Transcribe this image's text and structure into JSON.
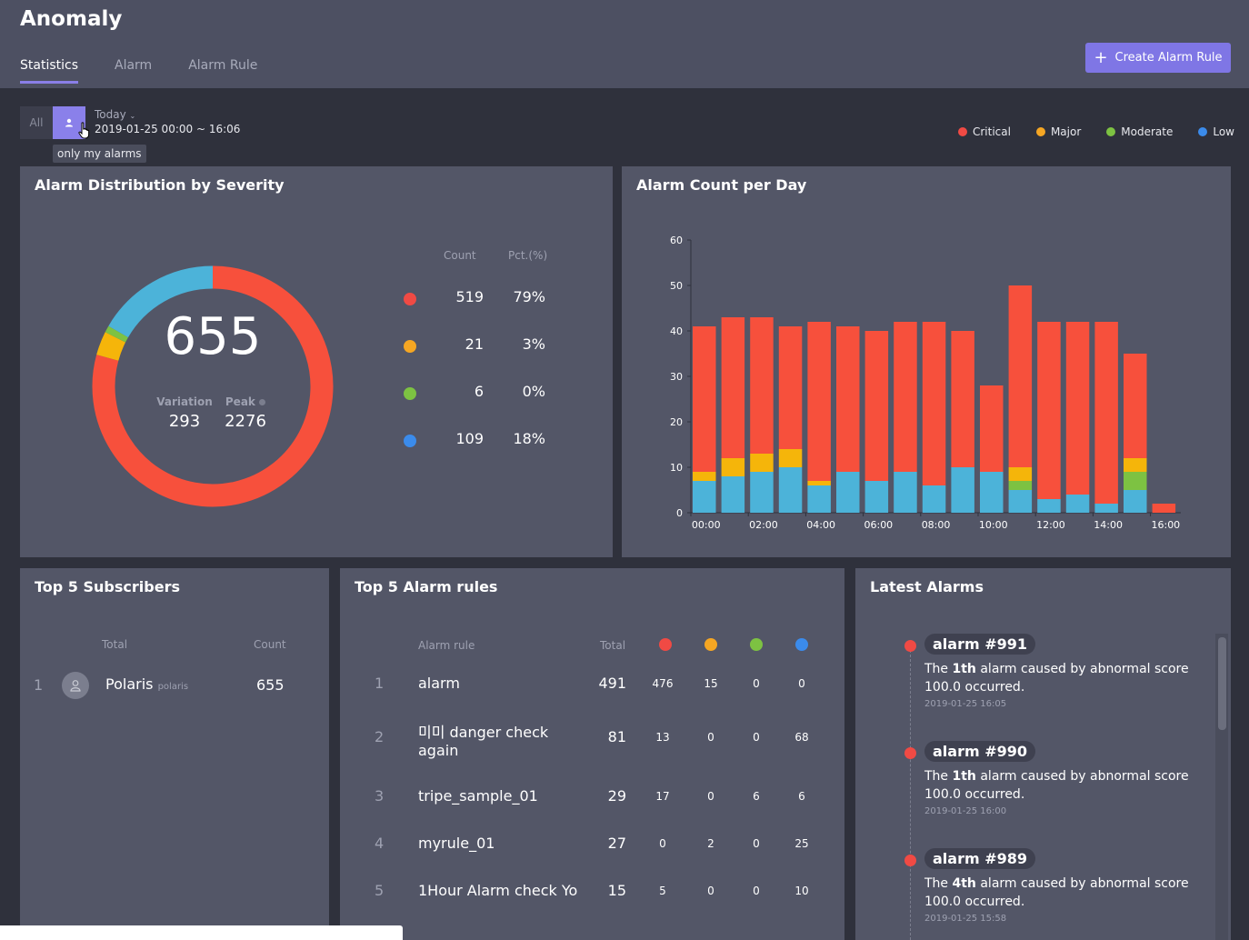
{
  "header": {
    "title": "Anomaly",
    "tabs": [
      "Statistics",
      "Alarm",
      "Alarm Rule"
    ],
    "create_button": "Create Alarm Rule"
  },
  "filter": {
    "all_label": "All",
    "tooltip": "only my alarms",
    "range_label": "Today",
    "range_value": "2019-01-25 00:00 ~ 16:06"
  },
  "legend": [
    {
      "label": "Critical",
      "color": "#f04a44"
    },
    {
      "label": "Major",
      "color": "#f5a623"
    },
    {
      "label": "Moderate",
      "color": "#7dc242"
    },
    {
      "label": "Low",
      "color": "#3b8beb"
    }
  ],
  "severity": {
    "title": "Alarm Distribution by Severity",
    "total": "655",
    "variation_label": "Variation",
    "variation_value": "293",
    "peak_label": "Peak",
    "peak_value": "2276",
    "col_count": "Count",
    "col_pct": "Pct.(%)",
    "rows": [
      {
        "count": "519",
        "pct": "79%",
        "color": "#f04a44"
      },
      {
        "count": "21",
        "pct": "3%",
        "color": "#f5a623"
      },
      {
        "count": "6",
        "pct": "0%",
        "color": "#7dc242"
      },
      {
        "count": "109",
        "pct": "18%",
        "color": "#3b8beb"
      }
    ],
    "donut": [
      {
        "label": "Critical",
        "value": 519,
        "color": "#f7503c"
      },
      {
        "label": "Major",
        "value": 21,
        "color": "#f5b50a"
      },
      {
        "label": "Moderate",
        "value": 6,
        "color": "#7dc242"
      },
      {
        "label": "Low",
        "value": 109,
        "color": "#4cb3d9"
      }
    ]
  },
  "chart_data": {
    "type": "bar",
    "title": "Alarm Count per Day",
    "xlabel": "",
    "ylabel": "",
    "ylim": [
      0,
      60
    ],
    "yticks": [
      0,
      10,
      20,
      30,
      40,
      50,
      60
    ],
    "xtick_labels": [
      "00:00",
      "02:00",
      "04:00",
      "06:00",
      "08:00",
      "10:00",
      "12:00",
      "14:00",
      "16:00"
    ],
    "categories": [
      "00:00",
      "01:00",
      "02:00",
      "03:00",
      "04:00",
      "05:00",
      "06:00",
      "07:00",
      "08:00",
      "09:00",
      "10:00",
      "11:00",
      "12:00",
      "13:00",
      "14:00",
      "15:00",
      "16:00"
    ],
    "stacked": true,
    "series": [
      {
        "name": "Low",
        "color": "#4cb3d9",
        "values": [
          7,
          8,
          9,
          10,
          6,
          9,
          7,
          9,
          6,
          10,
          9,
          5,
          3,
          4,
          2,
          5,
          0
        ]
      },
      {
        "name": "Moderate",
        "color": "#7dc242",
        "values": [
          0,
          0,
          0,
          0,
          0,
          0,
          0,
          0,
          0,
          0,
          0,
          2,
          0,
          0,
          0,
          4,
          0
        ]
      },
      {
        "name": "Major",
        "color": "#f5b50a",
        "values": [
          2,
          4,
          4,
          4,
          1,
          0,
          0,
          0,
          0,
          0,
          0,
          3,
          0,
          0,
          0,
          3,
          0
        ]
      },
      {
        "name": "Critical",
        "color": "#f7503c",
        "values": [
          32,
          31,
          30,
          27,
          35,
          32,
          33,
          33,
          36,
          30,
          19,
          40,
          39,
          38,
          40,
          23,
          2
        ]
      }
    ]
  },
  "subscribers": {
    "title": "Top 5 Subscribers",
    "col_total": "Total",
    "col_count": "Count",
    "rows": [
      {
        "rank": "1",
        "name": "Polaris",
        "id": "polaris",
        "count": "655"
      }
    ]
  },
  "rules": {
    "title": "Top 5 Alarm rules",
    "col_rule": "Alarm rule",
    "col_total": "Total",
    "rows": [
      {
        "rank": "1",
        "name": "alarm",
        "total": "491",
        "c": "476",
        "ma": "15",
        "mo": "0",
        "lo": "0"
      },
      {
        "rank": "2",
        "name": "미미 danger check again",
        "total": "81",
        "c": "13",
        "ma": "0",
        "mo": "0",
        "lo": "68"
      },
      {
        "rank": "3",
        "name": "tripe_sample_01",
        "total": "29",
        "c": "17",
        "ma": "0",
        "mo": "6",
        "lo": "6"
      },
      {
        "rank": "4",
        "name": "myrule_01",
        "total": "27",
        "c": "0",
        "ma": "2",
        "mo": "0",
        "lo": "25"
      },
      {
        "rank": "5",
        "name": "1Hour Alarm check Yo",
        "total": "15",
        "c": "5",
        "ma": "0",
        "mo": "0",
        "lo": "10"
      }
    ]
  },
  "latest": {
    "title": "Latest Alarms",
    "items": [
      {
        "badge": "alarm #991",
        "pre": "The ",
        "ord": "1th",
        "post": " alarm caused by abnormal score 100.0 occurred.",
        "time": "2019-01-25 16:05"
      },
      {
        "badge": "alarm #990",
        "pre": "The ",
        "ord": "1th",
        "post": " alarm caused by abnormal score 100.0 occurred.",
        "time": "2019-01-25 16:00"
      },
      {
        "badge": "alarm #989",
        "pre": "The ",
        "ord": "4th",
        "post": " alarm caused by abnormal score 100.0 occurred.",
        "time": "2019-01-25 15:58"
      }
    ]
  }
}
